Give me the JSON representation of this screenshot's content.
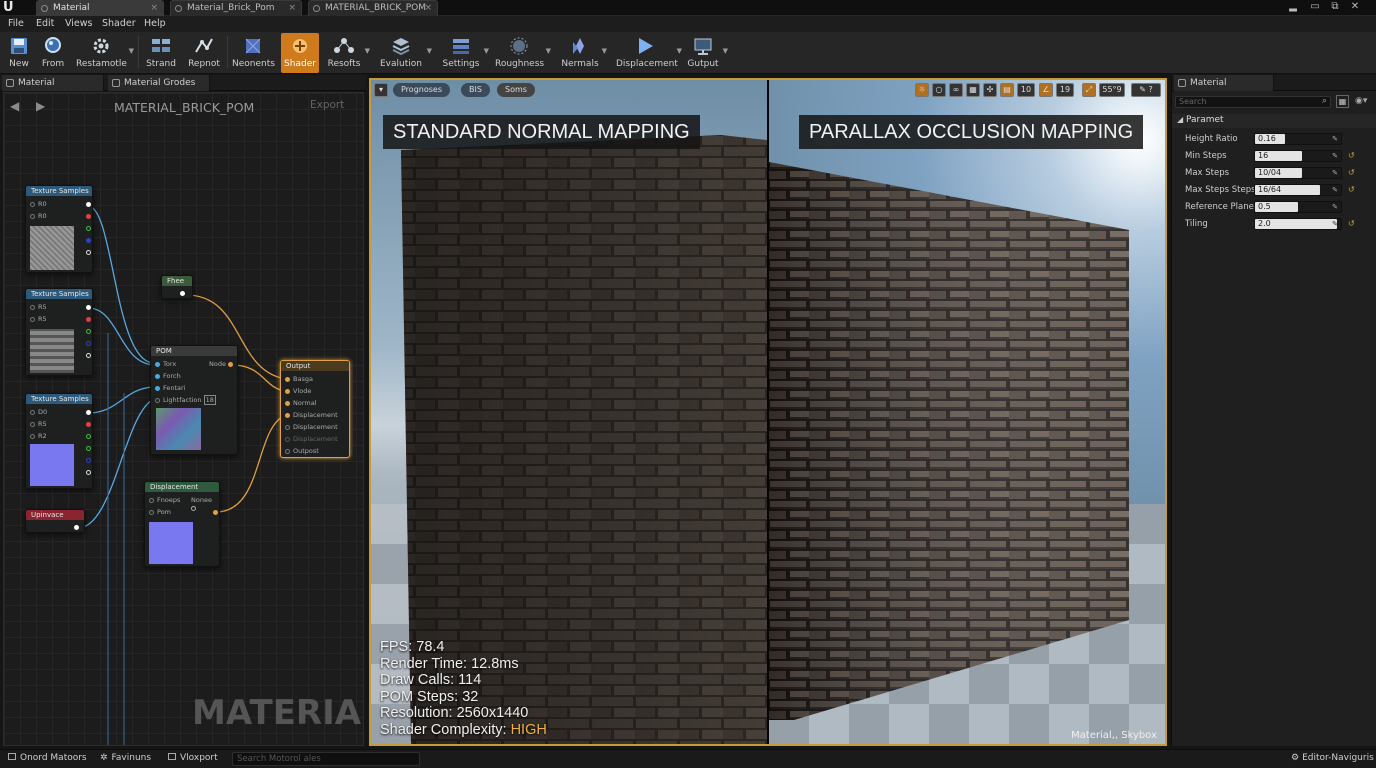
{
  "titlebar": {
    "tabs": [
      {
        "label": "Material",
        "active": true
      },
      {
        "label": "Material_Brick_Pom",
        "active": false
      },
      {
        "label": "MATERIAL_BRICK_POM",
        "active": false
      }
    ],
    "logo": "U"
  },
  "menu": [
    "File",
    "Edit",
    "Views",
    "Shader",
    "Help"
  ],
  "toolbar": {
    "items": [
      {
        "label": "New",
        "icon": "save-icon"
      },
      {
        "label": "From",
        "icon": "search-icon"
      },
      {
        "label": "Restamotle",
        "icon": "settings-gear-icon"
      },
      {
        "label": "Strand",
        "icon": "grid-icon"
      },
      {
        "label": "Repnot",
        "icon": "graph-icon"
      },
      {
        "label": "Neonents",
        "icon": "cube-icon"
      },
      {
        "label": "Shader",
        "icon": "shader-icon"
      },
      {
        "label": "Resofts",
        "icon": "nodes-icon"
      },
      {
        "label": "Evalution",
        "icon": "stack-icon"
      },
      {
        "label": "Settings",
        "icon": "settings-icon"
      },
      {
        "label": "Roughness",
        "icon": "roughness-icon"
      },
      {
        "label": "Nermals",
        "icon": "normals-icon"
      },
      {
        "label": "Displacement",
        "icon": "play-icon"
      },
      {
        "label": "Gutput",
        "icon": "output-icon"
      }
    ]
  },
  "left_panel": {
    "tabs": [
      "Material",
      "Material Grodes"
    ],
    "graph_title": "MATERIAL_BRICK_POM",
    "export_label": "Export",
    "watermark": "MATERIAL",
    "nodes": {
      "tex1": {
        "title": "Texture Samples",
        "pins": [
          "R0",
          "R0"
        ]
      },
      "tex2": {
        "title": "Texture Samples",
        "pins": [
          "R5",
          "R5"
        ]
      },
      "tex3": {
        "title": "Texture Samples",
        "pins": [
          "D0",
          "R5",
          "R2"
        ]
      },
      "uv": {
        "title": "Upinvace"
      },
      "pom": {
        "title": "POM",
        "pins": [
          "Torx",
          "Forch",
          "Fentari",
          "Lightfaction"
        ],
        "out": "Node",
        "badge": "18"
      },
      "param": {
        "title": "Fhee"
      },
      "disp": {
        "title": "Displacement",
        "pins": [
          "Fnoeps",
          "Pom"
        ],
        "out": "Nonee"
      },
      "output": {
        "title": "Output",
        "pins": [
          "Basga",
          "Vlode",
          "Normal",
          "Displacement",
          "Displacement",
          "Displacement",
          "Outpost"
        ]
      }
    }
  },
  "viewport": {
    "toolbar": [
      "Prognoses",
      "BIS",
      "Soms"
    ],
    "counters": [
      "10",
      "19",
      "55°9"
    ],
    "left_title": "STANDARD NORMAL MAPPING",
    "right_title": "PARALLAX OCCLUSION MAPPING",
    "stats": [
      {
        "label": "FPS:",
        "value": "78.4"
      },
      {
        "label": "Render Time:",
        "value": "12.8ms"
      },
      {
        "label": "Draw Calls:",
        "value": "114"
      },
      {
        "label": "POM Steps:",
        "value": "32"
      },
      {
        "label": "Resolution:",
        "value": "2560x1440"
      },
      {
        "label": "Shader Complexity:",
        "value": "HIGH"
      }
    ],
    "caption": "Material,, Skybox"
  },
  "details": {
    "tab": "Material",
    "search_placeholder": "Search",
    "section": "Paramet",
    "params": [
      {
        "label": "Height Ratio",
        "value": "0.16",
        "fill": 0.35
      },
      {
        "label": "Min Steps",
        "value": "16",
        "fill": 0.55
      },
      {
        "label": "Max Steps",
        "value": "10/04",
        "fill": 0.55
      },
      {
        "label": "Max Steps Steps",
        "value": "16/64",
        "fill": 0.75
      },
      {
        "label": "Reference Plane",
        "value": "0.5",
        "fill": 0.5
      },
      {
        "label": "Tiling",
        "value": "2.0",
        "fill": 0.95
      }
    ]
  },
  "statusbar": {
    "items": [
      "Onord Matoors",
      "Favinuns",
      "Vloxport"
    ],
    "search_placeholder": "Search Motorol ales",
    "right": "Editor-Naviguris"
  },
  "colors": {
    "accent": "#d07a1e",
    "viewport_border": "#c59a38",
    "panel": "#1f1f1f",
    "stat_high": "#f0b040"
  }
}
